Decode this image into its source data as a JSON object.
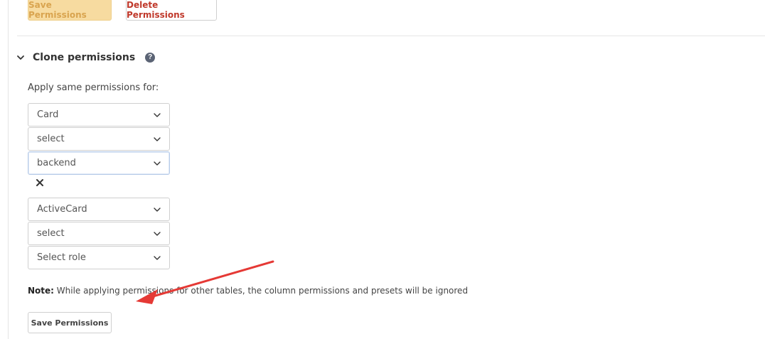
{
  "toolbar": {
    "save_label": "Save Permissions",
    "delete_label": "Delete Permissions"
  },
  "clone": {
    "title": "Clone permissions",
    "help_icon": "help-icon",
    "apply_label": "Apply same permissions for:",
    "groups": [
      {
        "table": "Card",
        "action": "select",
        "role": "backend"
      },
      {
        "table": "ActiveCard",
        "action": "select",
        "role": "Select role"
      }
    ],
    "note_prefix": "Note:",
    "note_text": " While applying permissions for other tables, the column permissions and presets will be ignored",
    "save_label": "Save Permissions"
  },
  "colors": {
    "save_top_bg": "#f7dba0",
    "delete_text": "#c0392b",
    "annotation_arrow": "#e53935"
  }
}
